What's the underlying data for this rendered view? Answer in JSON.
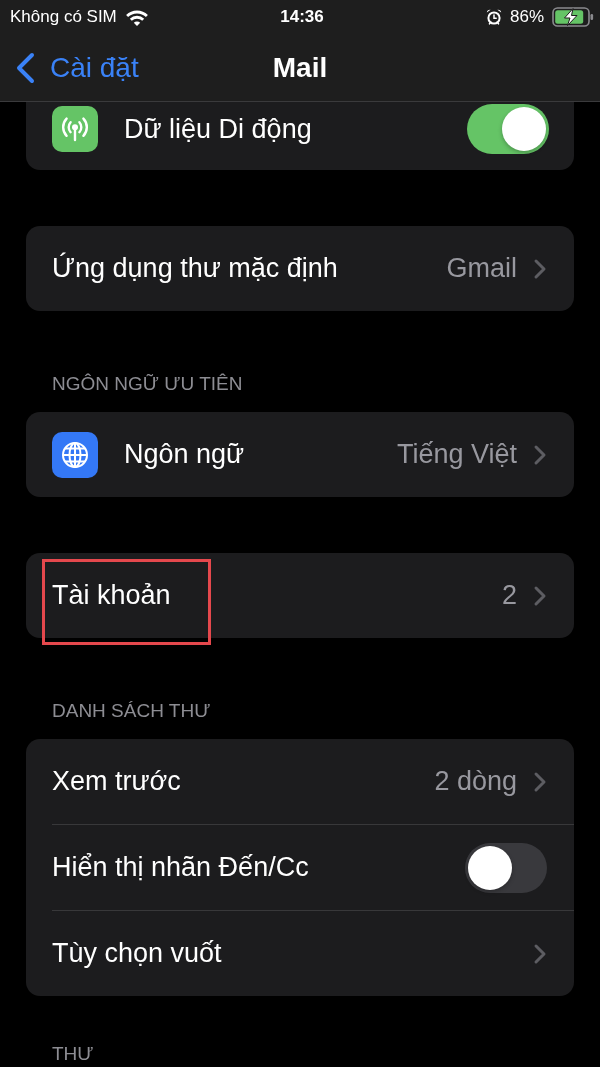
{
  "status_bar": {
    "carrier": "Không có SIM",
    "time": "14:36",
    "battery": "86%"
  },
  "nav_bar": {
    "back": "Cài đặt",
    "title": "Mail"
  },
  "sections": [
    {
      "rows": [
        {
          "kind": "cellular",
          "label": "Dữ liệu Di động",
          "on": true,
          "highlighted": false
        }
      ]
    },
    {
      "rows": [
        {
          "kind": "link",
          "label": "Ứng dụng thư mặc định",
          "value": "Gmail",
          "highlighted": false
        }
      ]
    },
    {
      "header": "NGÔN NGỮ ƯU TIÊN",
      "rows": [
        {
          "kind": "language",
          "label": "Ngôn ngữ",
          "value": "Tiếng Việt",
          "highlighted": false
        }
      ]
    },
    {
      "rows": [
        {
          "kind": "link",
          "label": "Tài khoản",
          "value": "2",
          "highlighted": true
        }
      ]
    },
    {
      "header": "DANH SÁCH THƯ",
      "rows": [
        {
          "kind": "link",
          "label": "Xem trước",
          "value": "2 dòng",
          "highlighted": false
        },
        {
          "kind": "toggle",
          "label": "Hiển thị nhãn Đến/Cc",
          "on": false,
          "highlighted": false
        },
        {
          "kind": "link",
          "label": "Tùy chọn vuốt",
          "highlighted": false
        }
      ]
    },
    {
      "header": "THƯ"
    }
  ]
}
